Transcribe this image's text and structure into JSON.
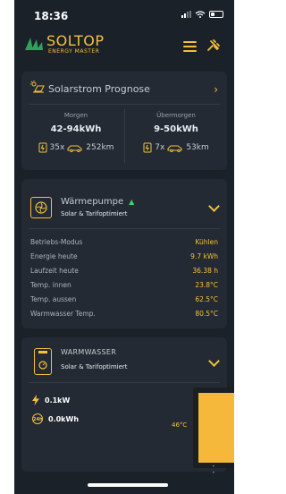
{
  "status": {
    "time": "18:36"
  },
  "brand": {
    "name": "SOLTOP",
    "sub": "ENERGY MASTER"
  },
  "colors": {
    "accent": "#f3c13b",
    "bg": "#1b2129",
    "card": "#232a33",
    "up": "#3dd16a"
  },
  "prognose": {
    "title": "Solarstrom Prognose",
    "morgen": {
      "label": "Morgen",
      "value": "42-94kWh",
      "charges": "35x",
      "distance": "252km"
    },
    "uebermorgen": {
      "label": "Übermorgen",
      "value": "9-50kWh",
      "charges": "7x",
      "distance": "53km"
    }
  },
  "waermepumpe": {
    "name": "Wärmepumpe",
    "trend": "▲",
    "subtitle": "Solar & Tarifoptimiert",
    "rows": [
      {
        "k": "Betriebs-Modus",
        "v": "Kühlen"
      },
      {
        "k": "Energie heute",
        "v": "9.7 kWh"
      },
      {
        "k": "Laufzeit heute",
        "v": "36.38 h"
      },
      {
        "k": "Temp. innen",
        "v": "23.8°C"
      },
      {
        "k": "Temp. aussen",
        "v": "62.5°C"
      },
      {
        "k": "Warmwasser Temp.",
        "v": "80.5°C"
      }
    ]
  },
  "warmwasser": {
    "name": "WARMWASSER",
    "subtitle": "Solar & Tarifoptimiert",
    "power": "0.1kW",
    "energy": "0.0kWh",
    "energy_badge": "24h",
    "temp": "46°C",
    "fill_fraction": 0.95
  }
}
